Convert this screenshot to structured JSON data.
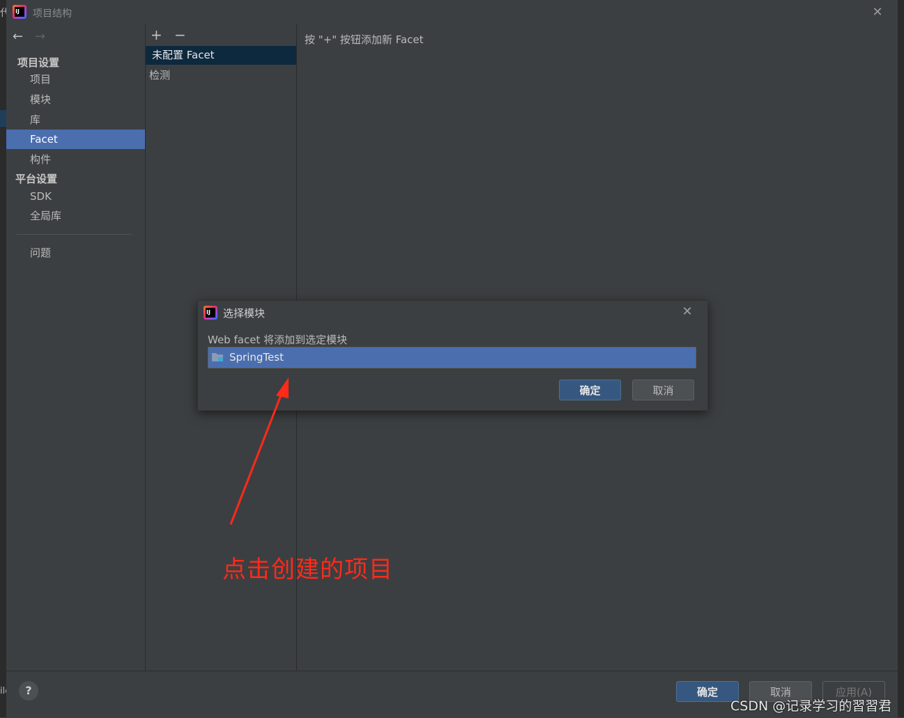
{
  "window": {
    "title": "项目结构",
    "bg_title_fragment": "代",
    "bg_bottom_fragment": "ile"
  },
  "sidebar": {
    "section_project": "项目设置",
    "section_platform": "平台设置",
    "items": [
      {
        "label": "项目"
      },
      {
        "label": "模块"
      },
      {
        "label": "库"
      },
      {
        "label": "Facet"
      },
      {
        "label": "构件"
      },
      {
        "label": "SDK"
      },
      {
        "label": "全局库"
      },
      {
        "label": "问题"
      }
    ],
    "selected": "Facet"
  },
  "middle": {
    "add_icon": "+",
    "remove_icon": "−",
    "items": [
      {
        "label": "未配置 Facet"
      },
      {
        "label": "检测"
      }
    ]
  },
  "content": {
    "hint": "按 \"+\" 按钮添加新 Facet"
  },
  "modal": {
    "title": "选择模块",
    "label": "Web facet 将添加到选定模块",
    "module": "SpringTest",
    "ok_label": "确定",
    "cancel_label": "取消"
  },
  "footer": {
    "help_label": "?",
    "ok_label": "确定",
    "cancel_label": "取消",
    "apply_label": "应用(A)"
  },
  "annotation": {
    "text": "点击创建的项目",
    "color": "#ff2a1a"
  },
  "watermark": "CSDN @记录学习的習習君",
  "colors": {
    "selection": "#4b6eaf",
    "primary_button": "#365880",
    "background": "#3c3f41"
  }
}
